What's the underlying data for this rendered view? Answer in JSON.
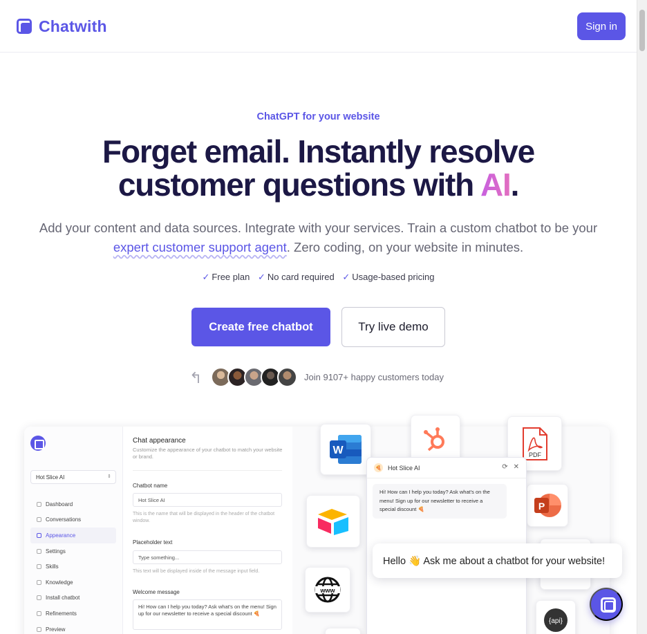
{
  "brand": {
    "name": "Chatwith",
    "color": "#5b56e6"
  },
  "header": {
    "signin_label": "Sign in"
  },
  "hero": {
    "eyebrow": "ChatGPT for your website",
    "headline_line1": "Forget email. Instantly resolve",
    "headline_line2_pre": "customer questions with ",
    "headline_ai": "AI",
    "headline_period": ".",
    "sub_pre": "Add your content and data sources. Integrate with your services. Train a custom chatbot to be your ",
    "sub_highlight": "expert customer support agent",
    "sub_post": ". Zero coding, on your website in minutes.",
    "checks": [
      "Free plan",
      "No card required",
      "Usage-based pricing"
    ],
    "check_glyph": "✓",
    "primary_cta": "Create free chatbot",
    "secondary_cta": "Try live demo",
    "social_proof": "Join 9107+ happy customers today",
    "arrow_glyph": "↰"
  },
  "mock": {
    "selected_bot": "Hot Slice AI",
    "nav": [
      "Dashboard",
      "Conversations",
      "Appearance",
      "Settings",
      "Skills",
      "Knowledge",
      "Install chatbot",
      "Refinements",
      "Preview"
    ],
    "active_nav": "Appearance",
    "form": {
      "title": "Chat appearance",
      "description": "Customize the appearance of your chatbot to match your website or brand.",
      "name_label": "Chatbot name",
      "name_value": "Hot Slice AI",
      "name_help": "This is the name that will be displayed in the header of the chatbot window.",
      "placeholder_label": "Placeholder text",
      "placeholder_value": "Type something...",
      "placeholder_help": "This text will be displayed inside of the message input field.",
      "welcome_label": "Welcome message",
      "welcome_value": "Hi! How can I help you today? Ask what's on the menu! Sign up for our newsletter to receive a special discount 🍕"
    },
    "chat": {
      "title": "Hot Slice AI",
      "bubble": "Hi! How can I help you today? Ask what's on the menu! Sign up for our newsletter to receive a special discount 🍕",
      "refresh_glyph": "⟳",
      "close_glyph": "✕"
    },
    "integrations": {
      "pdf_label": "PDF",
      "ppt_label": "P",
      "word_label": "W",
      "api_label": "{api}"
    }
  },
  "widget": {
    "greeting": "Hello 👋 Ask me about a chatbot for your website!"
  }
}
